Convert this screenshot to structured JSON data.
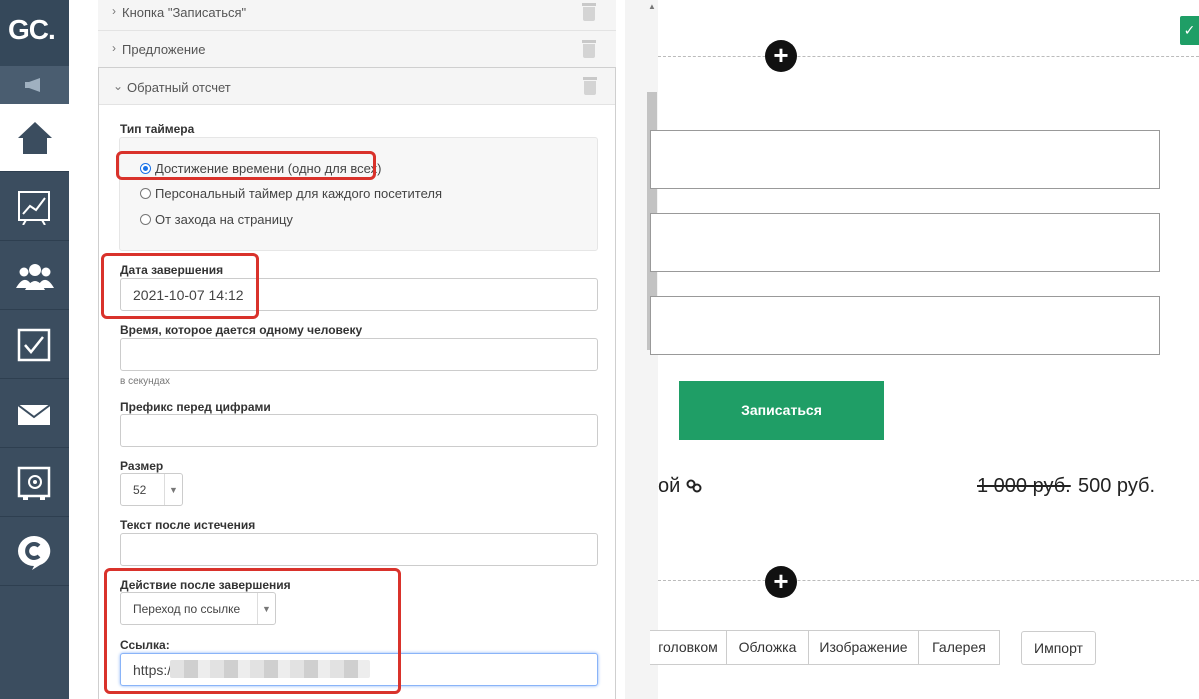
{
  "nav": {
    "logo": "GC.",
    "items": [
      "home-icon",
      "chart-icon",
      "users-icon",
      "tasks-icon",
      "mail-icon",
      "safe-icon",
      "chat-icon"
    ]
  },
  "editor": {
    "collapsed_sections": [
      {
        "label": "Кнопка \"Записаться\""
      },
      {
        "label": "Предложение"
      }
    ],
    "timer_section": {
      "label": "Обратный отсчет",
      "timer_type_label": "Тип таймера",
      "timer_options": [
        {
          "label": "Достижение времени (одно для всех)",
          "checked": true
        },
        {
          "label": "Персональный таймер для каждого посетителя",
          "checked": false
        },
        {
          "label": "От захода на страницу",
          "checked": false
        }
      ],
      "end_date_label": "Дата завершения",
      "end_date_value": "2021-10-07 14:12",
      "per_person_label": "Время, которое дается одному человеку",
      "per_person_value": "",
      "per_person_hint": "в секундах",
      "prefix_label": "Префикс перед цифрами",
      "prefix_value": "",
      "size_label": "Размер",
      "size_value": "52",
      "after_text_label": "Текст после истечения",
      "after_text_value": "",
      "action_label": "Действие после завершения",
      "action_value": "Переход по ссылке",
      "link_label": "Ссылка:",
      "link_value": "https:/"
    }
  },
  "preview": {
    "signup_button": "Записаться",
    "partial_text": "ой",
    "old_price": "1 000 руб.",
    "new_price": "500 руб.",
    "tabs": [
      "головком",
      "Обложка",
      "Изображение",
      "Галерея"
    ],
    "import_button": "Импорт",
    "plus_symbol": "+",
    "check_symbol": "✓"
  },
  "colors": {
    "nav_bg": "#3b4d5f",
    "accent_green": "#1f9e66",
    "highlight_red": "#d9322b",
    "radio_blue": "#1a73e8"
  }
}
